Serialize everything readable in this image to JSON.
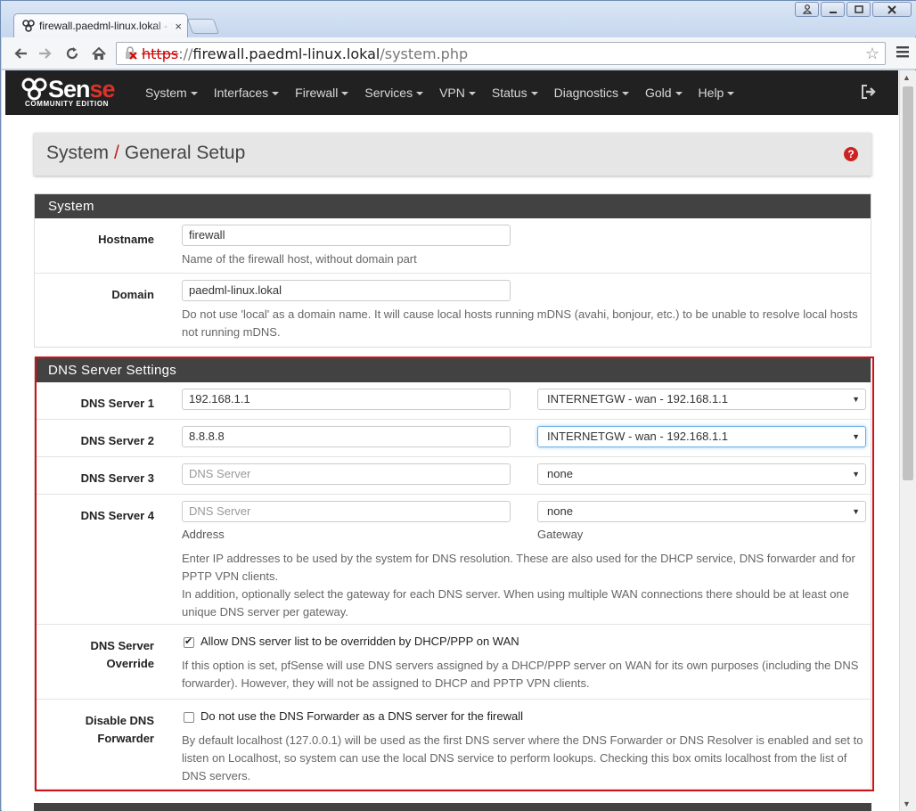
{
  "browser": {
    "tab_title": "firewall.paedml-linux.lokal - S",
    "tab_close": "×",
    "url_https": "https",
    "url_sep": "://",
    "url_host": "firewall.paedml-linux.lokal",
    "url_path": "/system.php"
  },
  "nav": {
    "logo_text_a": "S",
    "logo_text_b": "en",
    "logo_text_c": "se",
    "logo_sub": "COMMUNITY EDITION",
    "items": [
      "System",
      "Interfaces",
      "Firewall",
      "Services",
      "VPN",
      "Status",
      "Diagnostics",
      "Gold",
      "Help"
    ]
  },
  "header": {
    "section": "System",
    "separator": "/",
    "page": "General Setup",
    "help_glyph": "?"
  },
  "system_panel": {
    "title": "System",
    "hostname_label": "Hostname",
    "hostname_value": "firewall",
    "hostname_help": "Name of the firewall host, without domain part",
    "domain_label": "Domain",
    "domain_value": "paedml-linux.lokal",
    "domain_help": "Do not use 'local' as a domain name. It will cause local hosts running mDNS (avahi, bonjour, etc.) to be unable to resolve local hosts not running mDNS."
  },
  "dns_panel": {
    "title": "DNS Server Settings",
    "servers": [
      {
        "label": "DNS Server 1",
        "value": "192.168.1.1",
        "placeholder": "DNS Server",
        "gateway": "INTERNETGW - wan - 192.168.1.1"
      },
      {
        "label": "DNS Server 2",
        "value": "8.8.8.8",
        "placeholder": "DNS Server",
        "gateway": "INTERNETGW - wan - 192.168.1.1"
      },
      {
        "label": "DNS Server 3",
        "value": "",
        "placeholder": "DNS Server",
        "gateway": "none"
      },
      {
        "label": "DNS Server 4",
        "value": "",
        "placeholder": "DNS Server",
        "gateway": "none"
      }
    ],
    "address_label": "Address",
    "gateway_label": "Gateway",
    "help_1": "Enter IP addresses to be used by the system for DNS resolution. These are also used for the DHCP service, DNS forwarder and for PPTP VPN clients.",
    "help_2": "In addition, optionally select the gateway for each DNS server. When using multiple WAN connections there should be at least one unique DNS server per gateway.",
    "override_label_1": "DNS Server",
    "override_label_2": "Override",
    "override_checked": true,
    "override_text": "Allow DNS server list to be overridden by DHCP/PPP on WAN",
    "override_help": "If this option is set, pfSense will use DNS servers assigned by a DHCP/PPP server on WAN for its own purposes (including the DNS forwarder). However, they will not be assigned to DHCP and PPTP VPN clients.",
    "disable_label_1": "Disable DNS",
    "disable_label_2": "Forwarder",
    "disable_checked": false,
    "disable_text": "Do not use the DNS Forwarder as a DNS server for the firewall",
    "disable_help": "By default localhost (127.0.0.1) will be used as the first DNS server where the DNS Forwarder or DNS Resolver is enabled and set to listen on Localhost, so system can use the local DNS service to perform lookups. Checking this box omits localhost from the list of DNS servers."
  },
  "colors": {
    "navbar": "#212121",
    "accent": "#d9332a",
    "panel_heading": "#424242",
    "highlight": "#d0121b"
  }
}
